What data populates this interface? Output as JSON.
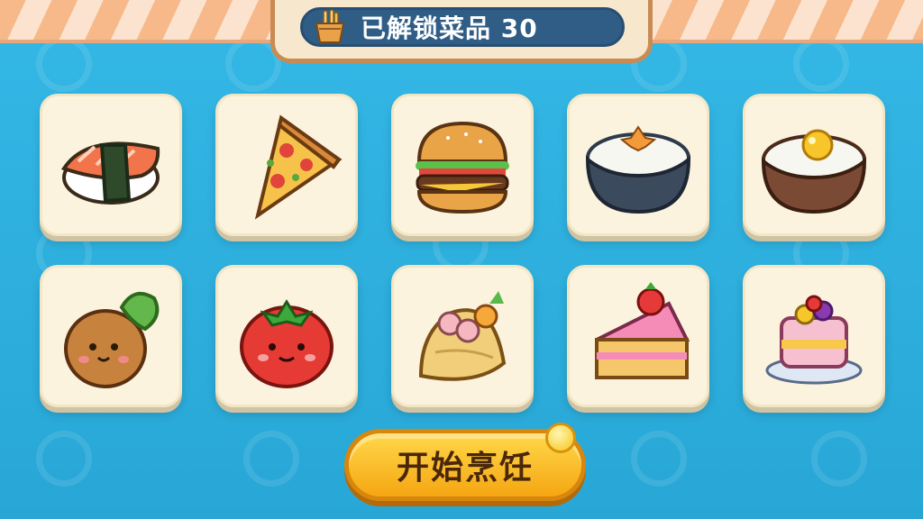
{
  "header": {
    "unlocked_label": "已解锁菜品 30",
    "icon": "basket-icon"
  },
  "dishes": [
    {
      "name": "sushi"
    },
    {
      "name": "pizza"
    },
    {
      "name": "burger"
    },
    {
      "name": "rice-bowl-carrot"
    },
    {
      "name": "rice-bowl-egg"
    },
    {
      "name": "potato"
    },
    {
      "name": "tomato"
    },
    {
      "name": "dumpling"
    },
    {
      "name": "strawberry-cake"
    },
    {
      "name": "berry-cake"
    }
  ],
  "action": {
    "start_label": "开始烹饪"
  },
  "colors": {
    "background": "#2fb3e0",
    "card": "#fbf3de",
    "button": "#f5a612",
    "banner": "#2f5d86"
  }
}
